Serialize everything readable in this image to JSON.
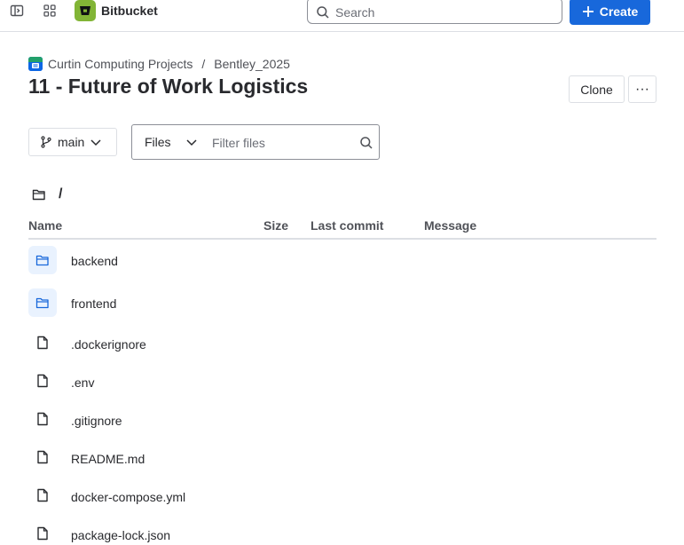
{
  "nav": {
    "product": "Bitbucket",
    "search_placeholder": "Search",
    "create_label": "Create"
  },
  "header": {
    "breadcrumbs": [
      "Curtin Computing Projects",
      "Bentley_2025"
    ],
    "separator": "/",
    "title": "11 - Future of Work Logistics",
    "clone_label": "Clone",
    "more_label": "···"
  },
  "toolbar": {
    "branch": "main",
    "filter_type": "Files",
    "filter_placeholder": "Filter files"
  },
  "path": "/",
  "table": {
    "headers": [
      "Name",
      "Size",
      "Last commit",
      "Message"
    ],
    "rows": [
      {
        "name": "backend",
        "type": "folder"
      },
      {
        "name": "frontend",
        "type": "folder"
      },
      {
        "name": ".dockerignore",
        "type": "file"
      },
      {
        "name": ".env",
        "type": "file"
      },
      {
        "name": ".gitignore",
        "type": "file"
      },
      {
        "name": "README.md",
        "type": "file"
      },
      {
        "name": "docker-compose.yml",
        "type": "file"
      },
      {
        "name": "package-lock.json",
        "type": "file"
      }
    ]
  },
  "colors": {
    "accent": "#1868DB",
    "brand": "#82B536",
    "folder_bg": "#E9F2FE"
  }
}
